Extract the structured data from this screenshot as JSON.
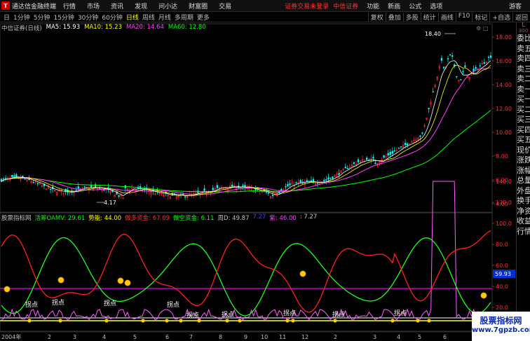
{
  "titlebar": {
    "app_name": "通达信金融终端",
    "menus": [
      "行情",
      "市场",
      "资讯",
      "发现",
      "问小达",
      "财富圈",
      "交易"
    ],
    "login_status": "证券交易未登录",
    "broker": "中信证券",
    "right_menus": [
      "功能",
      "新画",
      "公式",
      "选项"
    ],
    "user": "游客"
  },
  "periodbar": {
    "periods": [
      "日",
      "1分钟",
      "5分钟",
      "15分钟",
      "30分钟",
      "60分钟",
      "日线",
      "周线",
      "月线",
      "多周期",
      "更多"
    ],
    "active": "日线",
    "tools": [
      "复权",
      "叠加",
      "多股",
      "统计",
      "画线",
      "F10",
      "标记",
      "+自选",
      "返回"
    ]
  },
  "price_legend": {
    "security": "中信证券(日线)",
    "ma5": "MA5: 15.93",
    "ma10": "MA10: 15.23",
    "ma20": "MA20: 14.64",
    "ma60": "MA60: 12.80"
  },
  "indicator_legend": {
    "name": "股票指标网",
    "items": [
      {
        "text": "活筹OAMV: 29.61",
        "color": "#00ff00"
      },
      {
        "text": "势能: 44.00",
        "color": "#ffff00"
      },
      {
        "text": "做多资金: 67.09",
        "color": "#ff3030"
      },
      {
        "text": "做空资金: 6.11",
        "color": "#00ff00"
      },
      {
        "text": "周D: 49.87",
        "color": "#c0c0c0"
      },
      {
        "text": "7.27",
        "color": "#4040ff"
      },
      {
        "text": "紫: 46.00",
        "color": "#ff40ff"
      },
      {
        "text": ": 7.27",
        "color": "#c0c0c0"
      }
    ]
  },
  "price_axis": [
    "18.00",
    "16.00",
    "14.00",
    "12.00",
    "10.00",
    "8.00",
    "6.00",
    "4.00"
  ],
  "indicator_axis": [
    "140.0",
    "120.0",
    "100.0",
    "80.0",
    "60.0",
    "40.0",
    "20.0"
  ],
  "indicator_current": "59.93",
  "high_label": "18.40",
  "low_label": "4.17",
  "date_axis": [
    "2004年",
    "2",
    "3",
    "4",
    "5",
    "6",
    "7",
    "8",
    "9",
    "10",
    "11",
    "12",
    "2",
    "3",
    "4",
    "5",
    "6"
  ],
  "turn_label": "拐点",
  "turn_labels_count": 9,
  "sidebar": {
    "top_mark": "L",
    "top_num": "300",
    "items": [
      "委比",
      "卖五",
      "卖四",
      "卖三",
      "卖二",
      "卖一",
      "买一",
      "买二",
      "买三",
      "买四",
      "买五",
      "现价",
      "涨跌",
      "涨幅",
      "总量",
      "外盘",
      "换手",
      "净资",
      "收益",
      "行情"
    ]
  },
  "watermark": {
    "line1": "股票指标网",
    "line2": "www.7gpzb.com"
  },
  "colors": {
    "ma5": "#ffffff",
    "ma10": "#ffff00",
    "ma20": "#ff40ff",
    "ma60": "#00ff00",
    "up": "#ff3030",
    "down": "#00ffff",
    "red_line": "#ff2020",
    "green_line": "#20ff20",
    "pink_line": "#ff60ff",
    "yellow_line": "#ffff00",
    "magenta_ref": "#c000c0"
  }
}
